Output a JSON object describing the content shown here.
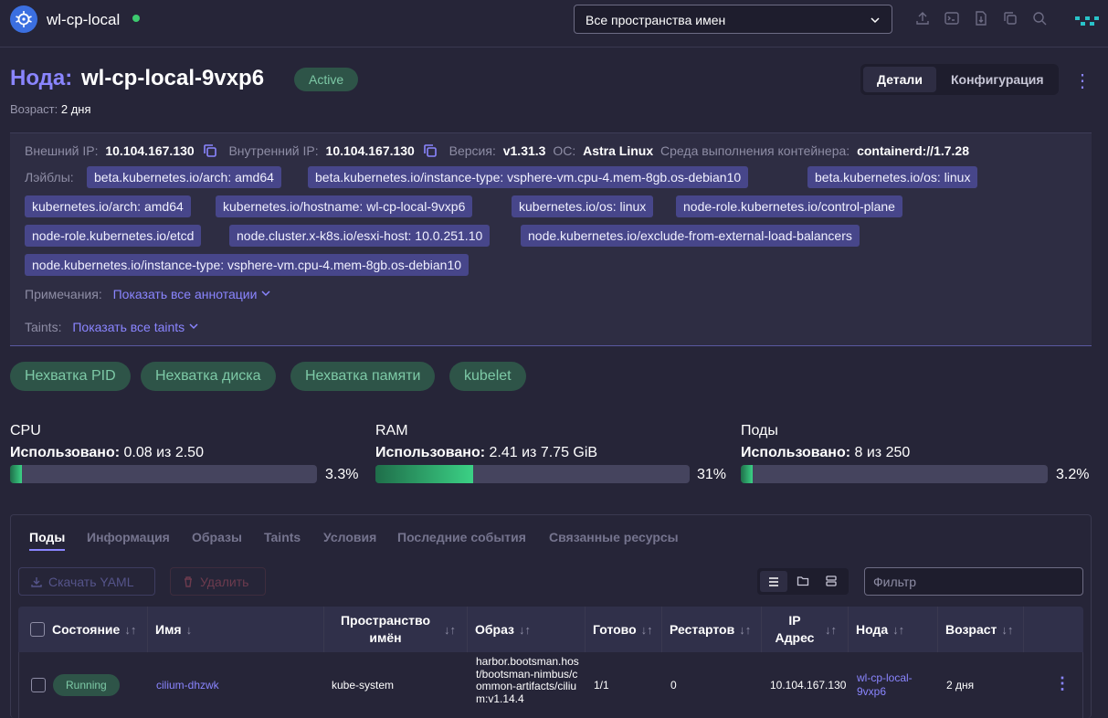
{
  "header": {
    "cluster_name": "wl-cp-local",
    "namespace_select": "Все пространства имен",
    "status_color": "#3dca6f"
  },
  "node": {
    "title_prefix": "Нода:",
    "name": "wl-cp-local-9vxp6",
    "status": "Active",
    "age_label": "Возраст:",
    "age_value": "2 дня",
    "view_tabs": [
      "Детали",
      "Конфигурация"
    ],
    "active_view_tab": "Детали"
  },
  "info": {
    "external_ip_label": "Внешний IP:",
    "external_ip": "10.104.167.130",
    "internal_ip_label": "Внутренний IP:",
    "internal_ip": "10.104.167.130",
    "version_label": "Версия:",
    "version": "v1.31.3",
    "os_label": "ОС:",
    "os": "Astra Linux",
    "runtime_label": "Среда выполнения контейнера:",
    "runtime": "containerd://1.7.28",
    "labels_label": "Лэйблы:",
    "labels": [
      "beta.kubernetes.io/arch: amd64",
      "beta.kubernetes.io/instance-type: vsphere-vm.cpu-4.mem-8gb.os-debian10",
      "beta.kubernetes.io/os: linux",
      "kubernetes.io/arch: amd64",
      "kubernetes.io/hostname: wl-cp-local-9vxp6",
      "kubernetes.io/os: linux",
      "node-role.kubernetes.io/control-plane",
      "node-role.kubernetes.io/etcd",
      "node.cluster.x-k8s.io/esxi-host: 10.0.251.10",
      "node.kubernetes.io/exclude-from-external-load-balancers",
      "node.kubernetes.io/instance-type: vsphere-vm.cpu-4.mem-8gb.os-debian10"
    ],
    "annotations_label": "Примечания:",
    "annotations_link": "Показать все аннотации",
    "taints_label": "Taints:",
    "taints_link": "Показать все taints"
  },
  "conditions": [
    "Нехватка PID",
    "Нехватка диска",
    "Нехватка памяти",
    "kubelet"
  ],
  "metrics": [
    {
      "title": "CPU",
      "used_label": "Использовано:",
      "used_text": "0.08 из 2.50",
      "percent_text": "3.3%",
      "fraction": 0.033
    },
    {
      "title": "RAM",
      "used_label": "Использовано:",
      "used_text": "2.41 из 7.75 GiB",
      "percent_text": "31%",
      "fraction": 0.31
    },
    {
      "title": "Поды",
      "used_label": "Использовано:",
      "used_text": "8 из 250",
      "percent_text": "3.2%",
      "fraction": 0.032
    }
  ],
  "tabs": [
    "Поды",
    "Информация",
    "Образы",
    "Taints",
    "Условия",
    "Последние события",
    "Связанные ресурсы"
  ],
  "active_tab": "Поды",
  "toolbar": {
    "download_yaml": "Скачать YAML",
    "delete": "Удалить",
    "filter_placeholder": "Фильтр"
  },
  "table": {
    "columns": [
      "Состояние",
      "Имя",
      "Пространство имён",
      "Образ",
      "Готово",
      "Рестартов",
      "IP Адрес",
      "Нода",
      "Возраст"
    ],
    "rows": [
      {
        "state": "Running",
        "name": "cilium-dhzwk",
        "namespace": "kube-system",
        "image": "harbor.bootsman.host/bootsman-nimbus/common-artifacts/cilium:v1.14.4",
        "ready": "1/1",
        "restarts": "0",
        "ip": "10.104.167.130",
        "node": "wl-cp-local-9vxp6",
        "age": "2 дня"
      }
    ]
  }
}
